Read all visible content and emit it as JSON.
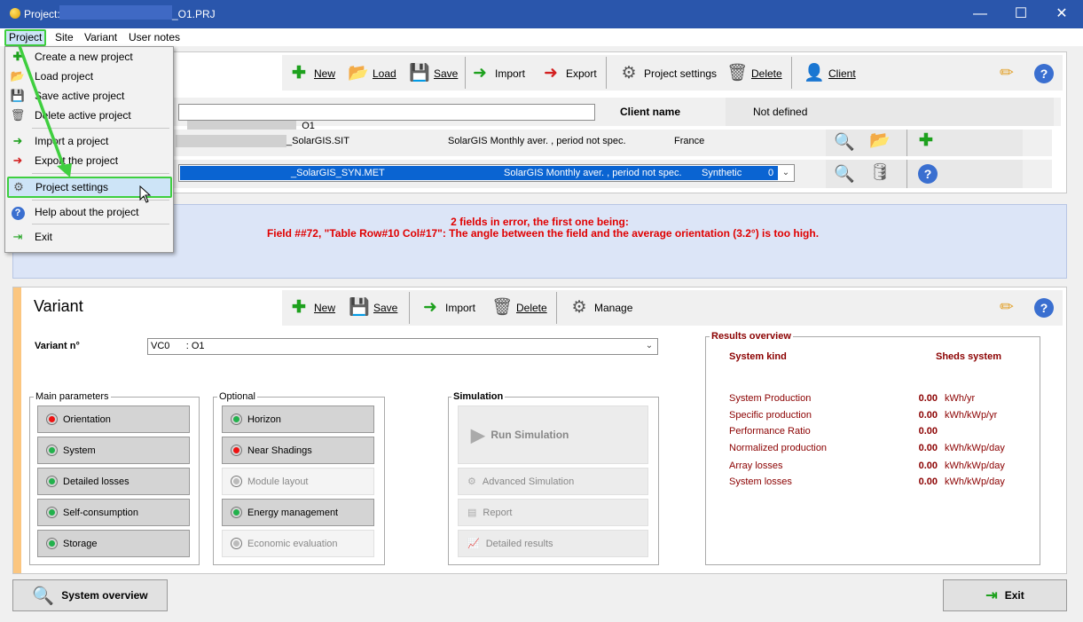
{
  "window": {
    "title_prefix": "Project:",
    "title_suffix": "_O1.PRJ",
    "minimize": "—",
    "maximize": "☐",
    "close": "✕"
  },
  "menubar": {
    "items": [
      "Project",
      "Site",
      "Variant",
      "User notes"
    ]
  },
  "project_toolbar": {
    "new": "New",
    "load": "Load",
    "save": "Save",
    "import": "Import",
    "export": "Export",
    "settings": "Project settings",
    "delete": "Delete",
    "client": "Client"
  },
  "project": {
    "name_value": "_O1",
    "client_label": "Client name",
    "client_value": "Not defined",
    "site_file": "_SolarGIS.SIT",
    "site_desc": "SolarGIS Monthly aver. , period not spec.",
    "site_country": "France",
    "meteo_file": "_SolarGIS_SYN.MET",
    "meteo_desc": "SolarGIS Monthly aver. , period not spec.",
    "meteo_type": "Synthetic",
    "meteo_extra": "0"
  },
  "errors": {
    "line1": "2 fields in error, the first one being:",
    "line2": "Field ##72, \"Table Row#10 Col#17\": The angle between the field and the average orientation (3.2°) is too high."
  },
  "variant": {
    "title": "Variant",
    "toolbar": {
      "new": "New",
      "save": "Save",
      "import": "Import",
      "delete": "Delete",
      "manage": "Manage"
    },
    "number_label": "Variant n°",
    "number_value": "VC0      : O1"
  },
  "main_parameters": {
    "title": "Main parameters",
    "items": [
      {
        "label": "Orientation",
        "status": "red"
      },
      {
        "label": "System",
        "status": "green"
      },
      {
        "label": "Detailed losses",
        "status": "green"
      },
      {
        "label": "Self-consumption",
        "status": "green"
      },
      {
        "label": "Storage",
        "status": "green"
      }
    ]
  },
  "optional": {
    "title": "Optional",
    "items": [
      {
        "label": "Horizon",
        "status": "green"
      },
      {
        "label": "Near Shadings",
        "status": "red"
      },
      {
        "label": "Module layout",
        "status": "gray"
      },
      {
        "label": "Energy management",
        "status": "green"
      },
      {
        "label": "Economic evaluation",
        "status": "gray"
      }
    ]
  },
  "simulation": {
    "title": "Simulation",
    "run": "Run Simulation",
    "advanced": "Advanced Simulation",
    "report": "Report",
    "detailed": "Detailed results"
  },
  "results": {
    "title": "Results overview",
    "system_kind_label": "System kind",
    "system_kind_value": "Sheds system",
    "rows": [
      {
        "label": "System Production",
        "value": "0.00",
        "unit": "kWh/yr"
      },
      {
        "label": "Specific production",
        "value": "0.00",
        "unit": "kWh/kWp/yr"
      },
      {
        "label": "Performance Ratio",
        "value": "0.00",
        "unit": ""
      },
      {
        "label": "Normalized production",
        "value": "0.00",
        "unit": "kWh/kWp/day"
      },
      {
        "label": "Array losses",
        "value": "0.00",
        "unit": "kWh/kWp/day"
      },
      {
        "label": "System losses",
        "value": "0.00",
        "unit": "kWh/kWp/day"
      }
    ]
  },
  "bottom": {
    "overview": "System overview",
    "exit": "Exit"
  },
  "dropdown": {
    "items": [
      {
        "label": "Create a new project",
        "icon": "plus-icon"
      },
      {
        "label": "Load project",
        "icon": "folder-icon"
      },
      {
        "label": "Save active project",
        "icon": "save-icon"
      },
      {
        "label": "Delete active project",
        "icon": "trash-icon"
      },
      {
        "label": "Import a project",
        "icon": "import-icon"
      },
      {
        "label": "Export the project",
        "icon": "export-icon"
      },
      {
        "label": "Project settings",
        "icon": "gear-icon"
      },
      {
        "label": "Help about the project",
        "icon": "help-icon"
      },
      {
        "label": "Exit",
        "icon": "exit-icon"
      }
    ]
  },
  "colors": {
    "titlebar": "#2a56ac",
    "highlight": "#cde4f7",
    "annotation": "#3fcf3f",
    "error": "#e00000",
    "result": "#8b0000",
    "selection": "#0a64d2"
  }
}
